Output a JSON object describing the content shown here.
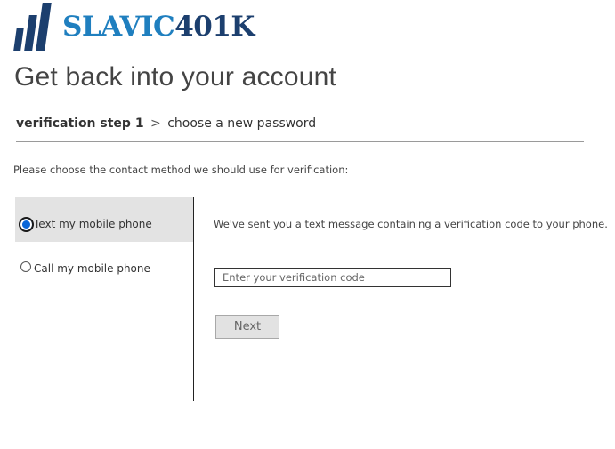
{
  "brand": {
    "name_part1": "SLAVIC",
    "name_part2": "401K",
    "primary_color": "#1f7fbf",
    "secondary_color": "#1c3f6e"
  },
  "page": {
    "title": "Get back into your account"
  },
  "breadcrumb": {
    "current": "verification step 1",
    "separator": ">",
    "next": "choose a new password"
  },
  "instructions": "Please choose the contact method we should use for verification:",
  "methods": [
    {
      "label": "Text my mobile phone",
      "selected": true
    },
    {
      "label": "Call my mobile phone",
      "selected": false
    }
  ],
  "verification": {
    "sent_message": "We've sent you a text message containing a verification code to your phone.",
    "input_placeholder": "Enter your verification code",
    "input_value": "",
    "next_label": "Next"
  }
}
